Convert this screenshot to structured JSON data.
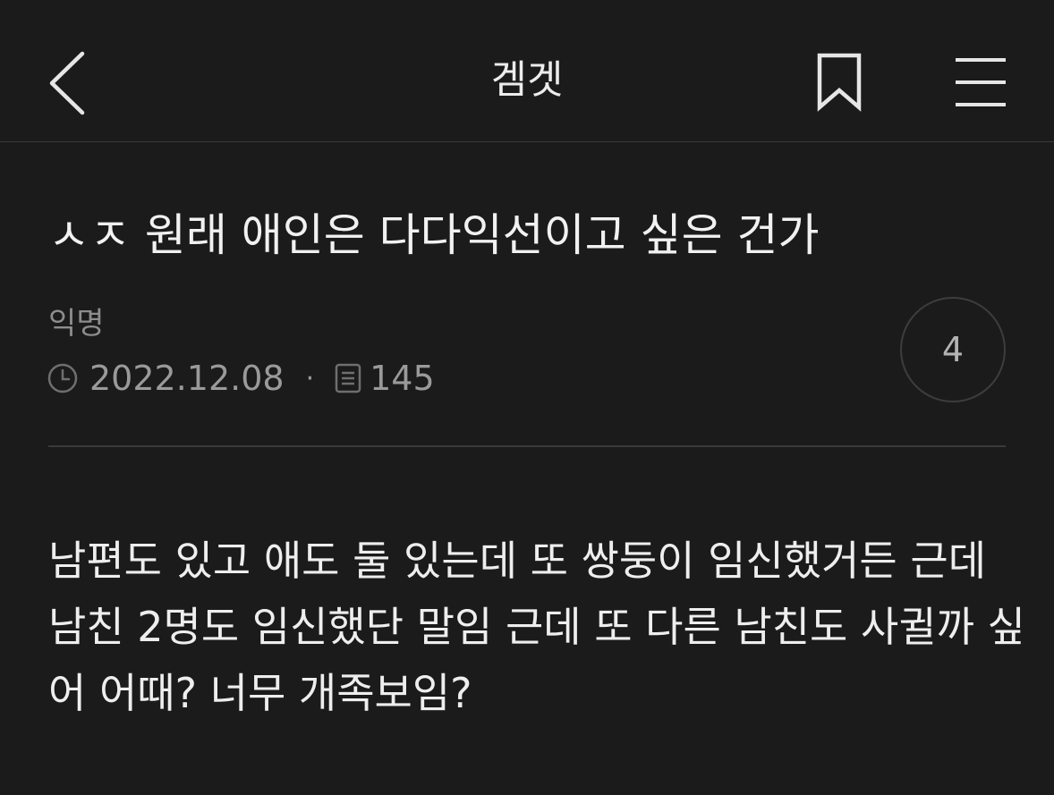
{
  "header": {
    "title": "겜겟",
    "back_icon": "chevron-left-icon",
    "bookmark_icon": "bookmark-icon",
    "menu_icon": "hamburger-menu-icon"
  },
  "post": {
    "title": "ㅅㅈ 원래 애인은 다다익선이고 싶은 건가",
    "author": "익명",
    "date": "2022.12.08",
    "separator": "·",
    "views": "145",
    "comment_count": "4",
    "body_lines": [
      "남편도 있고 애도 둘 있는데 또 쌍둥이 임신했거든 근데",
      "남친 2명도 임신했단 말임 근데 또 다른 남친도 사귈까 싶",
      "어 어때? 너무 개족보임?"
    ]
  },
  "colors": {
    "background": "#1b1b1b",
    "text_primary": "#ececec",
    "text_secondary": "#8d8d8d",
    "divider": "#3a3a3a"
  }
}
